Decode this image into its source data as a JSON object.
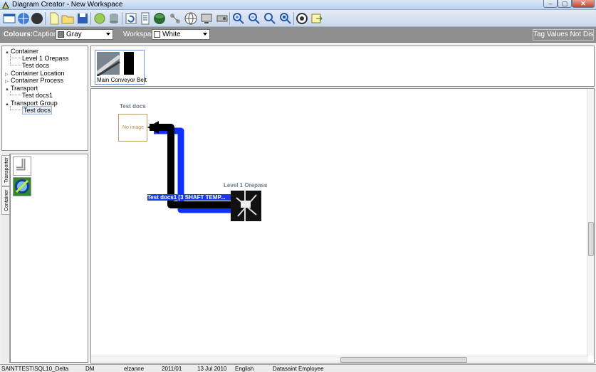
{
  "window": {
    "title": "Diagram Creator - New Workspace"
  },
  "toolbar": {
    "buttons": [
      "new-window-icon",
      "web-icon",
      "black-circle-icon",
      "new-document-icon",
      "open-folder-icon",
      "save-icon",
      "green-disc-icon",
      "database-icon",
      "refresh-icon",
      "properties-icon",
      "green-globe-icon",
      "connections-icon",
      "world-icon",
      "monitor-icon",
      "projector-icon",
      "zoom-in-icon",
      "zoom-out-icon",
      "zoom-fit-icon",
      "zoom-actual-icon",
      "settings-icon",
      "export-icon"
    ]
  },
  "colours_bar": {
    "label": "Colours:",
    "captions_label": "Captions",
    "captions_value": "Gray",
    "captions_swatch": "#808080",
    "workspace_label": "Workspace",
    "workspace_value": "White",
    "workspace_swatch": "#ffffff",
    "tag_status": "Tag Values Not Displayed"
  },
  "tree": {
    "items": [
      {
        "label": "Container",
        "expander": "▲"
      },
      {
        "label": "Level 1 Orepass",
        "expander": ""
      },
      {
        "label": "Test docs",
        "expander": ""
      },
      {
        "label": "Container Location",
        "expander": "▷"
      },
      {
        "label": "Container Process",
        "expander": "▷"
      },
      {
        "label": "Transport",
        "expander": "▲"
      },
      {
        "label": "Test docs1",
        "expander": ""
      },
      {
        "label": "Transport Group",
        "expander": "▲"
      },
      {
        "label": "Test docs",
        "expander": ""
      }
    ]
  },
  "side_tabs": {
    "transporter": "Transporter",
    "container": "Container"
  },
  "gallery": {
    "items": [
      {
        "caption": "Main Conveyor Belt"
      }
    ]
  },
  "canvas": {
    "node1_title": "Test docs",
    "node1_placeholder": "No image",
    "node2_title": "Level 1 Orepass",
    "connector_label": "Test docs1 [3 SHAFT TEMP..."
  },
  "status": {
    "server": "SAINTTEST\\SQL10_Delta",
    "module": "DM",
    "user": "elzanne",
    "period": "2011/01",
    "date": "13 Jul 2010",
    "language": "English",
    "role": "Datasaint Employee"
  }
}
